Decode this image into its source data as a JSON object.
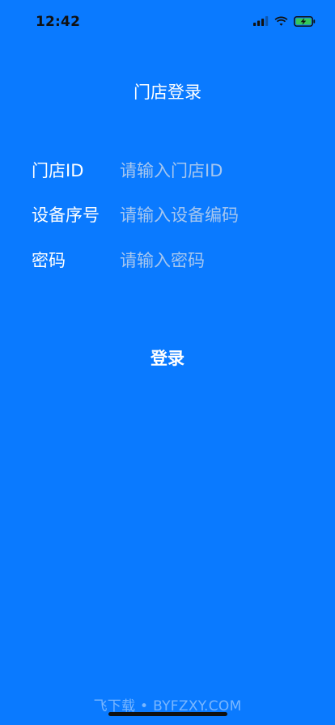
{
  "status_bar": {
    "time": "12:42",
    "icons": [
      "signal-icon",
      "wifi-icon",
      "battery-charging-icon"
    ]
  },
  "header": {
    "title": "门店登录"
  },
  "form": {
    "store_id": {
      "label": "门店ID",
      "placeholder": "请输入门店ID",
      "value": ""
    },
    "device_serial": {
      "label": "设备序号",
      "placeholder": "请输入设备编码",
      "value": ""
    },
    "password": {
      "label": "密码",
      "placeholder": "请输入密码",
      "value": ""
    }
  },
  "actions": {
    "login_label": "登录"
  },
  "watermark": {
    "text": "飞下载 • BYFZXY.COM"
  },
  "colors": {
    "background": "#0A7AFF",
    "text": "#FFFFFF",
    "placeholder": "#C8D7EB",
    "battery_fill": "#34C759",
    "status_text": "#111111"
  }
}
